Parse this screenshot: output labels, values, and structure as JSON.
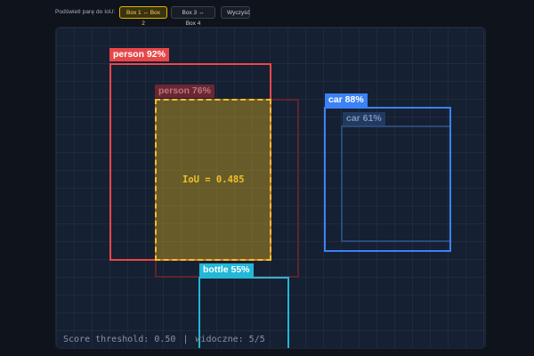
{
  "toolbar": {
    "label": "Podświetl parę do IoU:",
    "buttons": [
      {
        "label": "Box 1 ↔ Box 2",
        "active": true
      },
      {
        "label": "Box 3 ↔ Box 4",
        "active": false
      },
      {
        "label": "Wyczyść",
        "active": false
      }
    ]
  },
  "detections": [
    {
      "label": "person 92%",
      "color": "#e8474a"
    },
    {
      "label": "person 76%",
      "color": "#7a2d38"
    },
    {
      "label": "car 88%",
      "color": "#3b82f6"
    },
    {
      "label": "car 61%",
      "color": "#2f4f7f"
    },
    {
      "label": "bottle 55%",
      "color": "#22b8d6"
    }
  ],
  "iou": {
    "text": "IoU = 0.485",
    "color": "#f0c02a"
  },
  "footer": {
    "threshold": "Score threshold: 0.50",
    "separator": "|",
    "visible": "widoczne: 5/5"
  }
}
